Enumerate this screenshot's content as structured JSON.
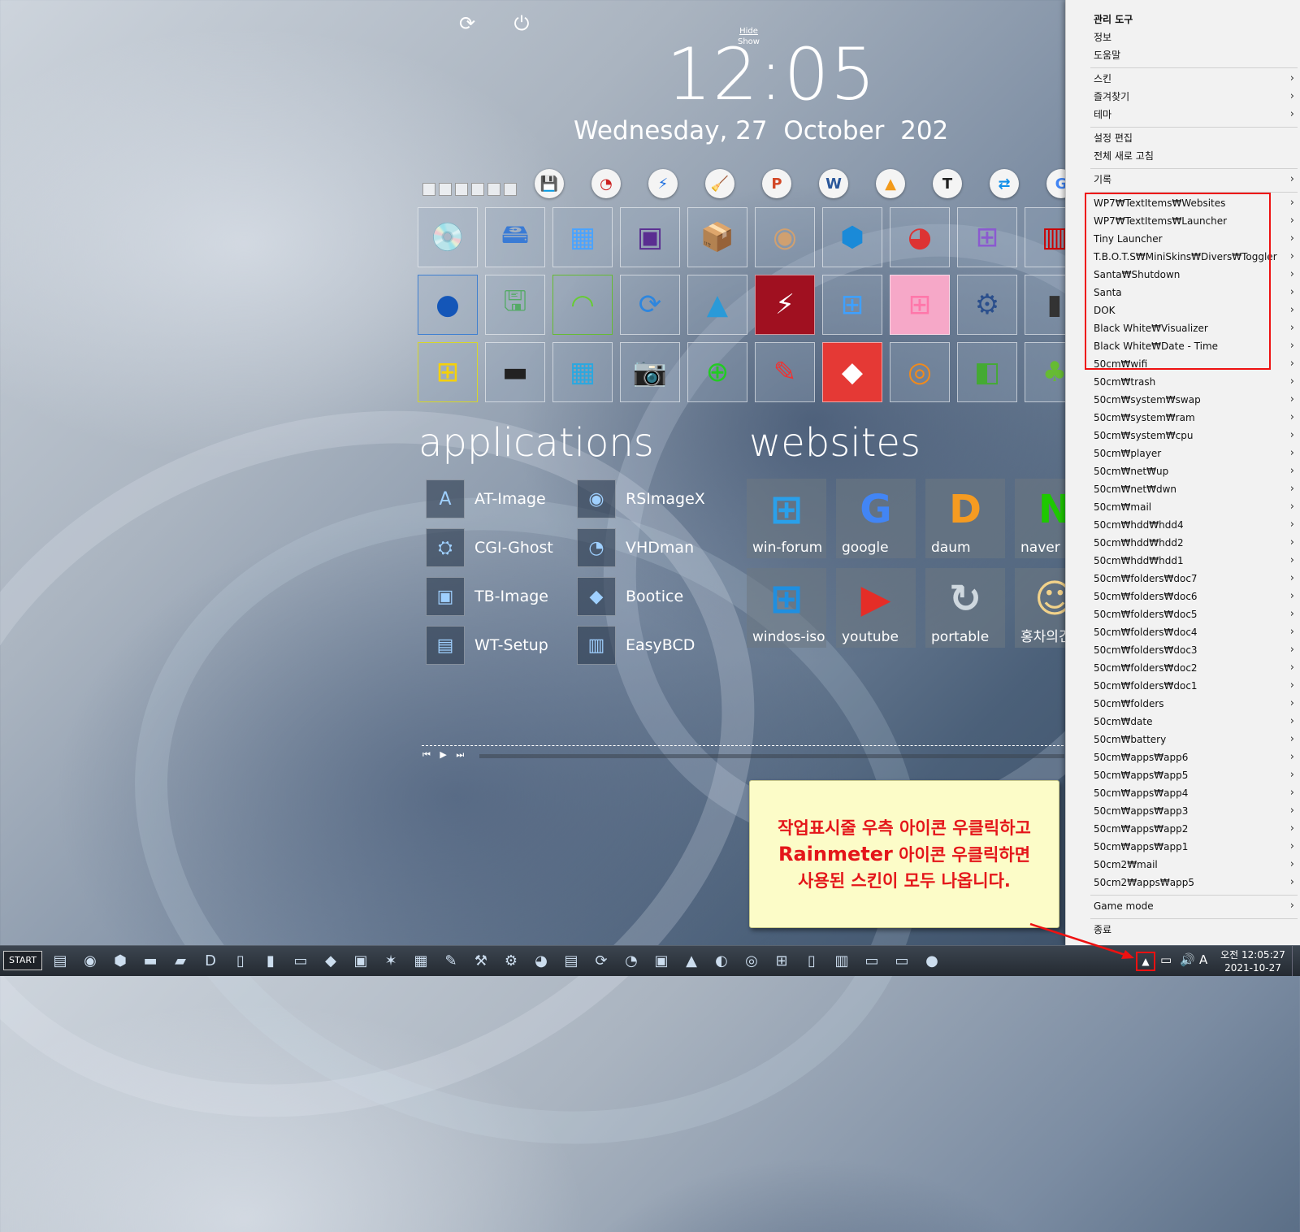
{
  "clock": {
    "time": "12:05",
    "date": "Wednesday, 27  October  202",
    "hide": "Hide",
    "show": "Show"
  },
  "top_icons": [
    "refresh-icon",
    "power-icon"
  ],
  "quick_icons": [
    {
      "name": "hdd-tool-icon",
      "glyph": "💾",
      "color": "#333"
    },
    {
      "name": "partition-tool-icon",
      "glyph": "◔",
      "color": "#c22"
    },
    {
      "name": "blue-app-icon",
      "glyph": "⚡",
      "color": "#1e6fe0"
    },
    {
      "name": "ccleaner-icon",
      "glyph": "🧹",
      "color": "#333"
    },
    {
      "name": "powerpoint-icon",
      "glyph": "P",
      "color": "#d24726"
    },
    {
      "name": "word-icon",
      "glyph": "W",
      "color": "#2b579a"
    },
    {
      "name": "aimp-icon",
      "glyph": "▲",
      "color": "#f29a1b"
    },
    {
      "name": "text-t-icon",
      "glyph": "T",
      "color": "#222"
    },
    {
      "name": "teamviewer-icon",
      "glyph": "⇄",
      "color": "#0e8ee9"
    },
    {
      "name": "google-translate-icon",
      "glyph": "G",
      "color": "#4285f4"
    }
  ],
  "launcher_tiles": [
    {
      "name": "tile-disk-editor",
      "glyph": "💿",
      "color": "#8a5ad0"
    },
    {
      "name": "tile-hdd-tool",
      "glyph": "🖴",
      "color": "#3a7bd5"
    },
    {
      "name": "tile-windows-blocks",
      "glyph": "▦",
      "color": "#4aa3ff"
    },
    {
      "name": "tile-cpu-z",
      "glyph": "▣",
      "color": "#5a2d91"
    },
    {
      "name": "tile-installer-box",
      "glyph": "📦",
      "color": "#c89b4a"
    },
    {
      "name": "tile-dvd-burner",
      "glyph": "◉",
      "color": "#d0a070"
    },
    {
      "name": "tile-registry",
      "glyph": "⬢",
      "color": "#1a8ad8"
    },
    {
      "name": "tile-partition-wizard",
      "glyph": "◕",
      "color": "#d33"
    },
    {
      "name": "tile-network-diagram",
      "glyph": "⊞",
      "color": "#8b5ad0"
    },
    {
      "name": "tile-red-grid",
      "glyph": "▥",
      "color": "#c00"
    },
    {
      "name": "tile-blue-dragon",
      "glyph": "●",
      "color": "#1456b8"
    },
    {
      "name": "tile-drive-backup",
      "glyph": "🖫",
      "color": "#5a6"
    },
    {
      "name": "tile-wifi",
      "glyph": "◠",
      "color": "#6c3"
    },
    {
      "name": "tile-sync",
      "glyph": "⟳",
      "color": "#2e86de"
    },
    {
      "name": "tile-aimp-triangle",
      "glyph": "▲",
      "color": "#2a9ad8"
    },
    {
      "name": "tile-flash-red",
      "glyph": "⚡",
      "color": "#fff"
    },
    {
      "name": "tile-windows-logo",
      "glyph": "⊞",
      "color": "#3fa0ff"
    },
    {
      "name": "tile-windows-pink",
      "glyph": "⊞",
      "color": "#f7a"
    },
    {
      "name": "tile-settings-gear",
      "glyph": "⚙",
      "color": "#2b4f8c"
    },
    {
      "name": "tile-memory-card",
      "glyph": "▮",
      "color": "#333"
    },
    {
      "name": "tile-windows-xp",
      "glyph": "⊞",
      "color": "#f5d10a"
    },
    {
      "name": "tile-usb-drive",
      "glyph": "▬",
      "color": "#222"
    },
    {
      "name": "tile-windows-blue-grid",
      "glyph": "▦",
      "color": "#2aa8e0"
    },
    {
      "name": "tile-snapshot-camera",
      "glyph": "📷",
      "color": "#444"
    },
    {
      "name": "tile-usb-add",
      "glyph": "⊕",
      "color": "#2c2"
    },
    {
      "name": "tile-notepad-add",
      "glyph": "✎",
      "color": "#e33"
    },
    {
      "name": "tile-anydesk",
      "glyph": "◆",
      "color": "#fff"
    },
    {
      "name": "tile-disc-orange",
      "glyph": "◎",
      "color": "#f08a1c"
    },
    {
      "name": "tile-cubes-green",
      "glyph": "◧",
      "color": "#4a3"
    },
    {
      "name": "tile-clover-folder",
      "glyph": "♣",
      "color": "#6b3"
    }
  ],
  "applications": {
    "title": "applications",
    "items": [
      {
        "label": "AT-Image",
        "icon": "at-image-icon",
        "glyph": "A"
      },
      {
        "label": "CGI-Ghost",
        "icon": "cgi-ghost-icon",
        "glyph": "⛭"
      },
      {
        "label": "TB-Image",
        "icon": "tb-image-icon",
        "glyph": "▣"
      },
      {
        "label": "WT-Setup",
        "icon": "wt-setup-icon",
        "glyph": "▤"
      },
      {
        "label": "RSImageX",
        "icon": "rsimagex-icon",
        "glyph": "◉"
      },
      {
        "label": "VHDman",
        "icon": "vhdman-icon",
        "glyph": "◔"
      },
      {
        "label": "Bootice",
        "icon": "bootice-icon",
        "glyph": "◆"
      },
      {
        "label": "EasyBCD",
        "icon": "easybcd-icon",
        "glyph": "▥"
      }
    ]
  },
  "websites": {
    "title": "websites",
    "items": [
      {
        "label": "win-forum",
        "icon": "windows-icon",
        "glyph": "⊞",
        "color": "#2aa0ea"
      },
      {
        "label": "google",
        "icon": "google-icon",
        "glyph": "G",
        "color": "#4285f4"
      },
      {
        "label": "daum",
        "icon": "daum-icon",
        "glyph": "D",
        "color": "#f59b21"
      },
      {
        "label": "naver",
        "icon": "naver-icon",
        "glyph": "N",
        "color": "#1ec800"
      },
      {
        "label": "windos-iso",
        "icon": "windows-iso-icon",
        "glyph": "⊞",
        "color": "#1f8fe0"
      },
      {
        "label": "youtube",
        "icon": "youtube-icon",
        "glyph": "▶",
        "color": "#e52d27"
      },
      {
        "label": "portable",
        "icon": "portable-icon",
        "glyph": "↻",
        "color": "#cfd8df"
      },
      {
        "label": "홍차의긴",
        "icon": "hongcha-avatar-icon",
        "glyph": "☺",
        "color": "#f2d28a"
      }
    ]
  },
  "media_controls": "⏮ ▶ ⏭",
  "note": {
    "line1": "작업표시줄 우측 아이콘 우클릭하고",
    "line2_strong": "Rainmeter",
    "line2_rest": " 아이콘 우클릭하면",
    "line3": "사용된 스킨이 모두 나옵니다."
  },
  "menu": {
    "head_items": [
      {
        "label": "관리 도구",
        "bold": true
      },
      {
        "label": "정보"
      },
      {
        "label": "도움말"
      }
    ],
    "sub_items": [
      {
        "label": "스킨",
        "arrow": true
      },
      {
        "label": "즐겨찾기",
        "arrow": true
      },
      {
        "label": "테마",
        "arrow": true
      }
    ],
    "edit_items": [
      {
        "label": "설정 편집"
      },
      {
        "label": "전체 새로 고침"
      }
    ],
    "log_item": {
      "label": "기록",
      "arrow": true
    },
    "skins": [
      "WP7₩TextItems₩Websites",
      "WP7₩TextItems₩Launcher",
      "Tiny Launcher",
      "T.B.O.T.S₩MiniSkins₩Divers₩Toggler",
      "Santa₩Shutdown",
      "Santa",
      "DOK",
      "Black  White₩Visualizer",
      "Black  White₩Date - Time",
      "50cm₩wifi",
      "50cm₩trash",
      "50cm₩system₩swap",
      "50cm₩system₩ram",
      "50cm₩system₩cpu",
      "50cm₩player",
      "50cm₩net₩up",
      "50cm₩net₩dwn",
      "50cm₩mail",
      "50cm₩hdd₩hdd4",
      "50cm₩hdd₩hdd2",
      "50cm₩hdd₩hdd1",
      "50cm₩folders₩doc7",
      "50cm₩folders₩doc6",
      "50cm₩folders₩doc5",
      "50cm₩folders₩doc4",
      "50cm₩folders₩doc3",
      "50cm₩folders₩doc2",
      "50cm₩folders₩doc1",
      "50cm₩folders",
      "50cm₩date",
      "50cm₩battery",
      "50cm₩apps₩app6",
      "50cm₩apps₩app5",
      "50cm₩apps₩app4",
      "50cm₩apps₩app3",
      "50cm₩apps₩app2",
      "50cm₩apps₩app1",
      "50cm2₩mail",
      "50cm2₩apps₩app5"
    ],
    "game_mode": "Game mode",
    "exit": "종료"
  },
  "taskbar": {
    "start": "START",
    "pinned": [
      {
        "name": "tb-network-icon",
        "glyph": "▤"
      },
      {
        "name": "tb-blue-circle-icon",
        "glyph": "◉"
      },
      {
        "name": "tb-registry-icon",
        "glyph": "⬢"
      },
      {
        "name": "tb-terminal-icon",
        "glyph": "▬"
      },
      {
        "name": "tb-eraser-icon",
        "glyph": "▰"
      },
      {
        "name": "tb-d-icon",
        "glyph": "D"
      },
      {
        "name": "tb-doc-icon",
        "glyph": "▯"
      },
      {
        "name": "tb-red-bars-icon",
        "glyph": "▮"
      },
      {
        "name": "tb-drive-icon",
        "glyph": "▭"
      },
      {
        "name": "tb-diamond-icon",
        "glyph": "◆"
      },
      {
        "name": "tb-pc-icon",
        "glyph": "▣"
      },
      {
        "name": "tb-star-icon",
        "glyph": "✶"
      },
      {
        "name": "tb-box-icon",
        "glyph": "▦"
      },
      {
        "name": "tb-paint-icon",
        "glyph": "✎"
      },
      {
        "name": "tb-tool-icon",
        "glyph": "⚒"
      },
      {
        "name": "tb-gear-pc-icon",
        "glyph": "⚙"
      },
      {
        "name": "tb-pie-icon",
        "glyph": "◕"
      },
      {
        "name": "tb-installer-icon",
        "glyph": "▤"
      },
      {
        "name": "tb-sync-icon",
        "glyph": "⟳"
      },
      {
        "name": "tb-partition-icon",
        "glyph": "◔"
      },
      {
        "name": "tb-pc2-icon",
        "glyph": "▣"
      },
      {
        "name": "tb-aimp-icon",
        "glyph": "▲"
      },
      {
        "name": "tb-vhd-icon",
        "glyph": "◐"
      },
      {
        "name": "tb-dvd-icon",
        "glyph": "◎"
      },
      {
        "name": "tb-windows-pink-icon",
        "glyph": "⊞"
      },
      {
        "name": "tb-file-icon",
        "glyph": "▯"
      },
      {
        "name": "tb-red-grid-icon",
        "glyph": "▥"
      },
      {
        "name": "tb-folder-icon",
        "glyph": "▭"
      },
      {
        "name": "tb-folder2-icon",
        "glyph": "▭"
      },
      {
        "name": "tb-rainmeter-icon",
        "glyph": "●"
      }
    ],
    "tray_up": "▲",
    "tray": [
      {
        "name": "network-tray-icon",
        "glyph": "▭"
      },
      {
        "name": "volume-tray-icon",
        "glyph": "🔊"
      },
      {
        "name": "ime-tray-icon",
        "glyph": "A"
      }
    ],
    "clock_time": "오전 12:05:27",
    "clock_date": "2021-10-27"
  }
}
